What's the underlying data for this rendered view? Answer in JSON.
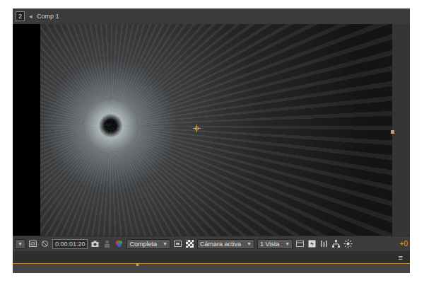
{
  "panel": {
    "number": "2",
    "arrow": "◂",
    "title": "Comp 1"
  },
  "toolbar": {
    "zoom_arrow": "▼",
    "timecode": "0:00:01:20",
    "resolution": {
      "value": "Completa",
      "arrow": "▼"
    },
    "view": {
      "value": "Cámara activa",
      "arrow": "▼"
    },
    "layout": {
      "value": "1 Vista",
      "arrow": "▼"
    },
    "exposure": "+0"
  },
  "timeline": {
    "menu": "≡"
  }
}
